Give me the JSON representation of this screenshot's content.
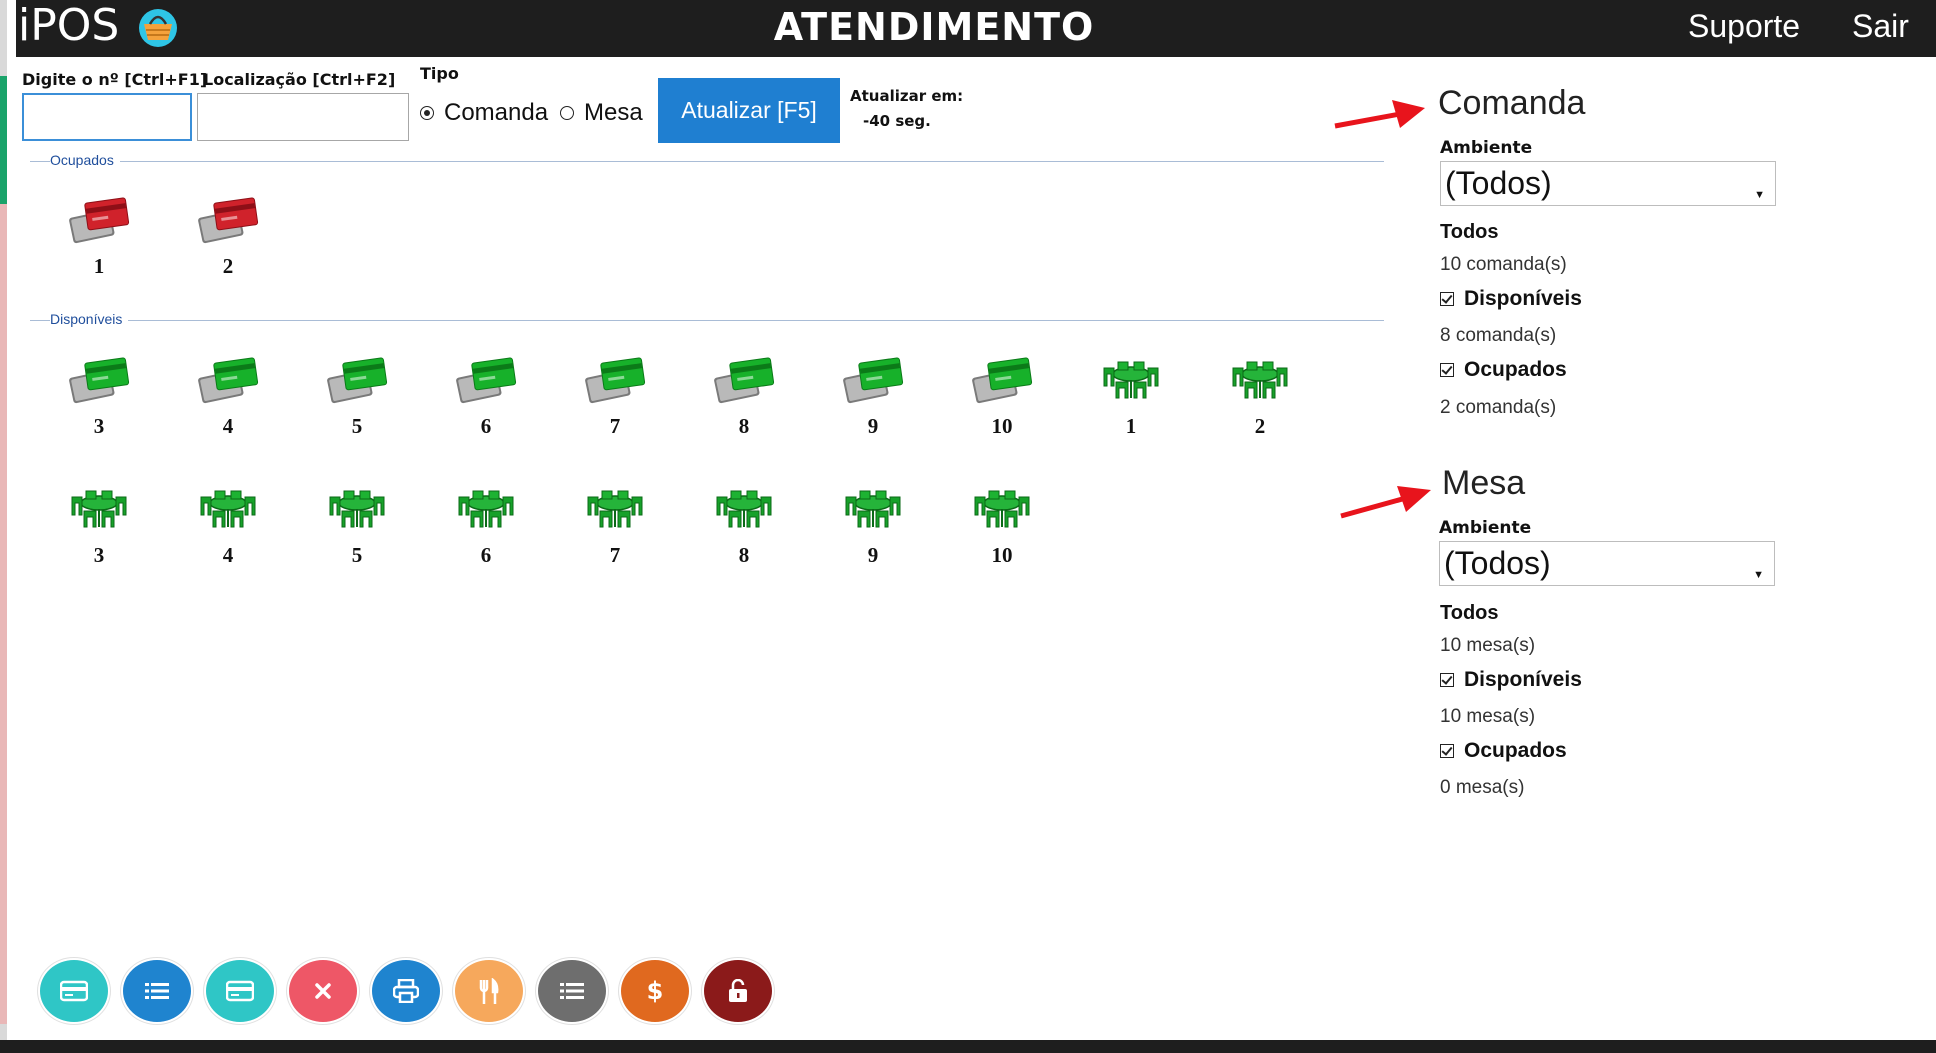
{
  "header": {
    "logo_text": "iPOS",
    "logo_icon": "basket-icon",
    "title": "ATENDIMENTO",
    "nav": [
      "Suporte",
      "Sair"
    ]
  },
  "search": {
    "numero_label": "Digite o nº  [Ctrl+F1]",
    "numero_value": "",
    "localizacao_label": "Localização  [Ctrl+F2]",
    "localizacao_value": "",
    "tipo_label": "Tipo",
    "tipo_options": [
      "Comanda",
      "Mesa"
    ],
    "tipo_selected": "Comanda",
    "refresh_button": "Atualizar [F5]",
    "refresh_in_label": "Atualizar em:",
    "refresh_in_value": "-40 seg."
  },
  "groups": {
    "ocupados_label": "Ocupados",
    "disponiveis_label": "Disponíveis",
    "ocupados": [
      {
        "kind": "comanda",
        "icon": "card-red-icon",
        "number": "1"
      },
      {
        "kind": "comanda",
        "icon": "card-red-icon",
        "number": "2"
      }
    ],
    "disponiveis": [
      {
        "kind": "comanda",
        "icon": "card-green-icon",
        "number": "3"
      },
      {
        "kind": "comanda",
        "icon": "card-green-icon",
        "number": "4"
      },
      {
        "kind": "comanda",
        "icon": "card-green-icon",
        "number": "5"
      },
      {
        "kind": "comanda",
        "icon": "card-green-icon",
        "number": "6"
      },
      {
        "kind": "comanda",
        "icon": "card-green-icon",
        "number": "7"
      },
      {
        "kind": "comanda",
        "icon": "card-green-icon",
        "number": "8"
      },
      {
        "kind": "comanda",
        "icon": "card-green-icon",
        "number": "9"
      },
      {
        "kind": "comanda",
        "icon": "card-green-icon",
        "number": "10"
      },
      {
        "kind": "mesa",
        "icon": "table-green-icon",
        "number": "1"
      },
      {
        "kind": "mesa",
        "icon": "table-green-icon",
        "number": "2"
      },
      {
        "kind": "mesa",
        "icon": "table-green-icon",
        "number": "3"
      },
      {
        "kind": "mesa",
        "icon": "table-green-icon",
        "number": "4"
      },
      {
        "kind": "mesa",
        "icon": "table-green-icon",
        "number": "5"
      },
      {
        "kind": "mesa",
        "icon": "table-green-icon",
        "number": "6"
      },
      {
        "kind": "mesa",
        "icon": "table-green-icon",
        "number": "7"
      },
      {
        "kind": "mesa",
        "icon": "table-green-icon",
        "number": "8"
      },
      {
        "kind": "mesa",
        "icon": "table-green-icon",
        "number": "9"
      },
      {
        "kind": "mesa",
        "icon": "table-green-icon",
        "number": "10"
      }
    ]
  },
  "side": {
    "comanda": {
      "title": "Comanda",
      "ambiente_label": "Ambiente",
      "ambiente_value": "(Todos)",
      "todos_label": "Todos",
      "todos_count": "10 comanda(s)",
      "disponiveis_label": "Disponíveis",
      "disponiveis_count": "8 comanda(s)",
      "ocupados_label": "Ocupados",
      "ocupados_count": "2 comanda(s)"
    },
    "mesa": {
      "title": "Mesa",
      "ambiente_label": "Ambiente",
      "ambiente_value": "(Todos)",
      "todos_label": "Todos",
      "todos_count": "10 mesa(s)",
      "disponiveis_label": "Disponíveis",
      "disponiveis_count": "10 mesa(s)",
      "ocupados_label": "Ocupados",
      "ocupados_count": "0 mesa(s)"
    }
  },
  "colors": {
    "header_bg": "#1e1e1e",
    "accent_blue": "#1f7fd1",
    "arrow_red": "#e8141c",
    "occupied_red": "#d0222b",
    "available_green": "#17b12a"
  },
  "action_buttons": [
    {
      "icon": "card-icon",
      "color": "#2fc6c6"
    },
    {
      "icon": "list-icon",
      "color": "#1f84cf"
    },
    {
      "icon": "card-icon",
      "color": "#2fc6c6"
    },
    {
      "icon": "close-icon",
      "color": "#ee5767"
    },
    {
      "icon": "print-icon",
      "color": "#1f84cf"
    },
    {
      "icon": "cutlery-icon",
      "color": "#f6a85c"
    },
    {
      "icon": "list-icon",
      "color": "#6e6e6e"
    },
    {
      "icon": "dollar-icon",
      "color": "#e0691f"
    },
    {
      "icon": "unlock-icon",
      "color": "#8b1a1a"
    }
  ]
}
